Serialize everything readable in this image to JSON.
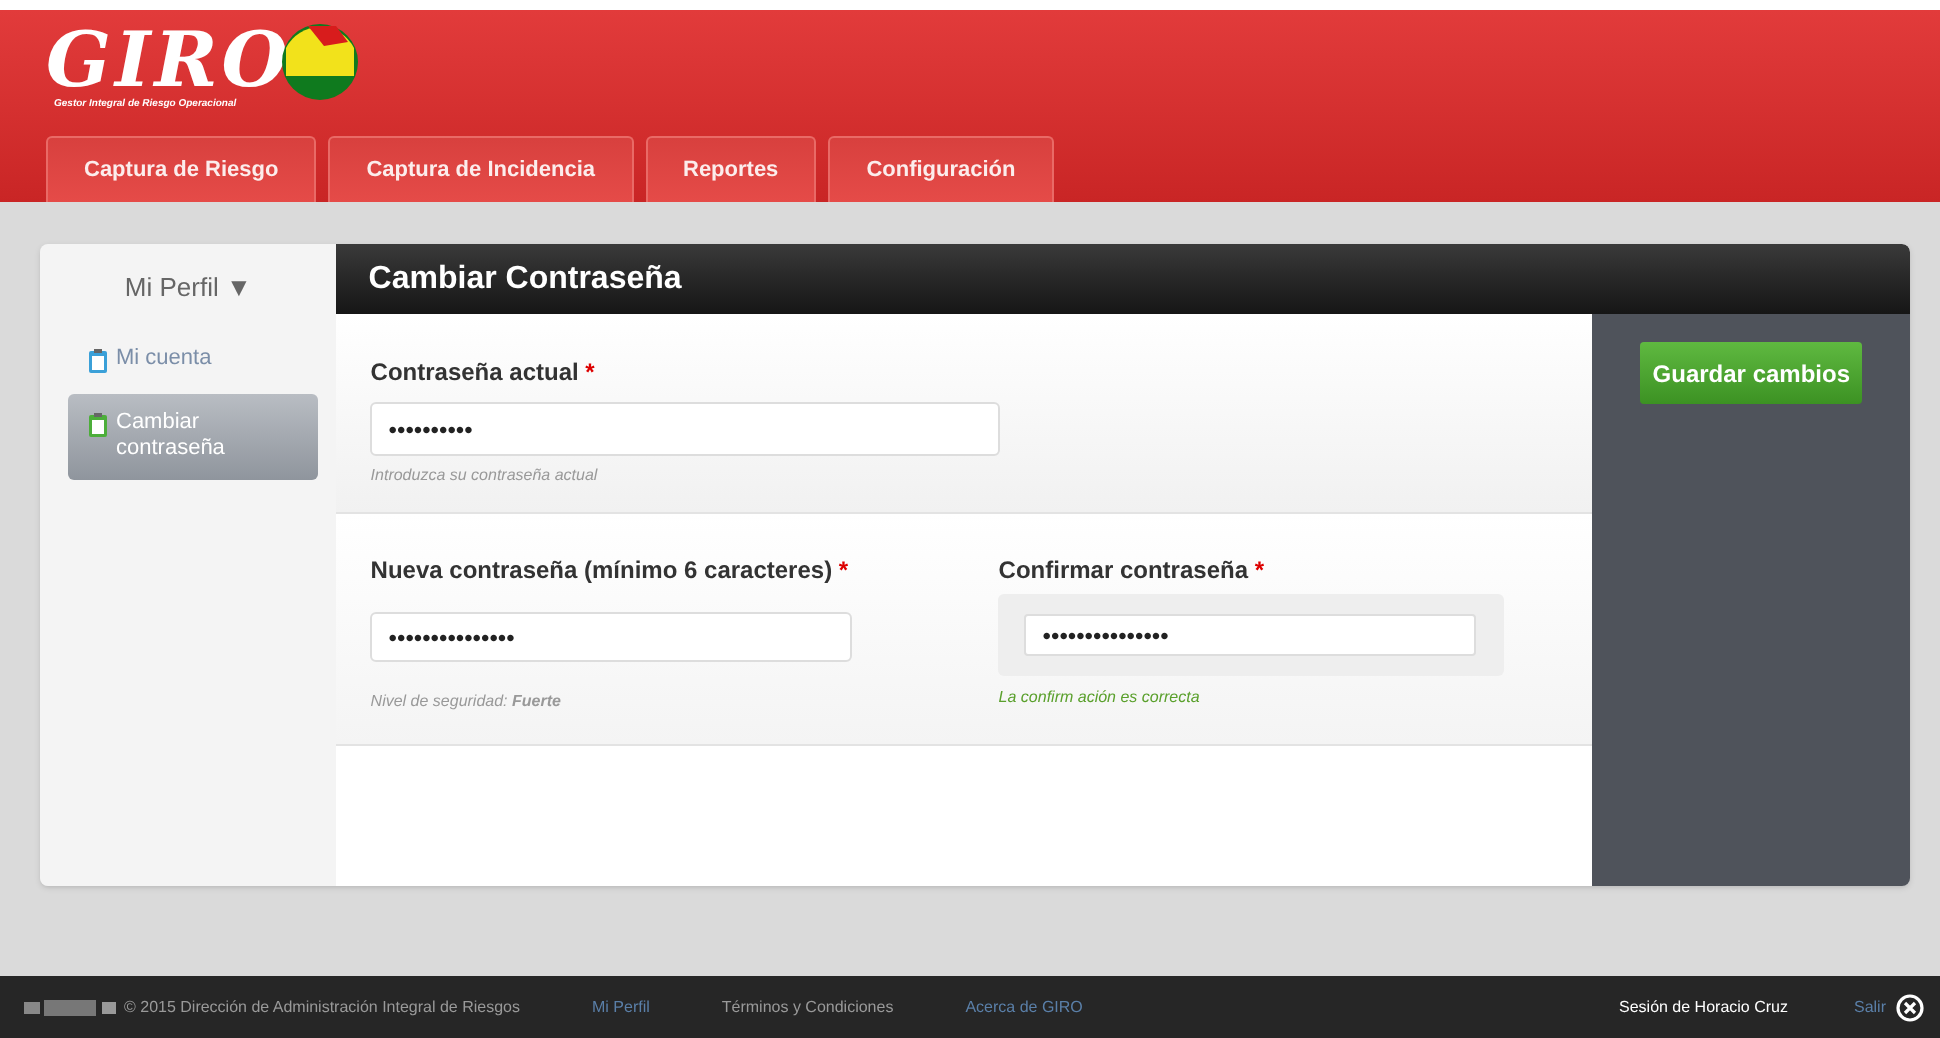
{
  "logo": {
    "title": "GIRO",
    "subtitle": "Gestor Integral de Riesgo Operacional"
  },
  "tabs": [
    {
      "label": "Captura de Riesgo",
      "selected": false
    },
    {
      "label": "Captura de Incidencia",
      "selected": false
    },
    {
      "label": "Reportes",
      "selected": false
    },
    {
      "label": "Configuración",
      "selected": false
    }
  ],
  "sidebar": {
    "title": "Mi Perfil ▼",
    "items": [
      {
        "label": "Mi cuenta",
        "selected": false
      },
      {
        "label": "Cambiar contraseña",
        "selected": true
      }
    ]
  },
  "panel": {
    "title": "Cambiar Contraseña",
    "current": {
      "label": "Contraseña actual",
      "required": "*",
      "value": "••••••••••",
      "help": "Introduzca su contraseña actual"
    },
    "new": {
      "label": "Nueva contraseña (mínimo 6 caracteres)",
      "required": "*",
      "value": "•••••••••••••••",
      "help_label": "Nivel de seguridad: ",
      "help_value": "Fuerte"
    },
    "confirm": {
      "label": "Confirmar contraseña",
      "required": "*",
      "value": "•••••••••••••••",
      "help": "La confirm ación es correcta"
    },
    "save_button": "Guardar cambios"
  },
  "footer": {
    "copyright": "© 2015 Dirección de Administración Integral de Riesgos",
    "links": [
      "Mi Perfil",
      "Términos y Condiciones",
      "Acerca de GIRO"
    ],
    "session": "Sesión de Horacio Cruz",
    "logout": "Salir"
  }
}
